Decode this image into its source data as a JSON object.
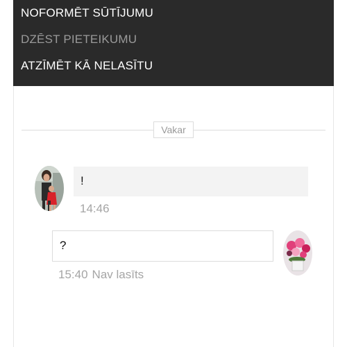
{
  "context_menu": {
    "items": [
      {
        "label": "NOFORMĒT SŪTĪJUMU",
        "enabled": true
      },
      {
        "label": "DZĒST PIETEIKUMU",
        "enabled": false
      },
      {
        "label": "ATZĪMĒT KĀ NELASĪTU",
        "enabled": true
      }
    ]
  },
  "chat": {
    "date_divider": "Vakar",
    "messages": [
      {
        "direction": "incoming",
        "avatar": "photo-avatar-woman-child",
        "text": "!",
        "time": "14:46"
      },
      {
        "direction": "outgoing",
        "avatar": "photo-avatar-flowers",
        "text": "?",
        "time": "15:40",
        "status": "Nav lasīts"
      }
    ]
  },
  "colors": {
    "menu_background": "#2a2a2a",
    "menu_text": "#ffffff",
    "menu_text_disabled": "#9a9a9a",
    "incoming_bubble": "#f3f3f3",
    "meta_text": "#a5a5a5"
  }
}
